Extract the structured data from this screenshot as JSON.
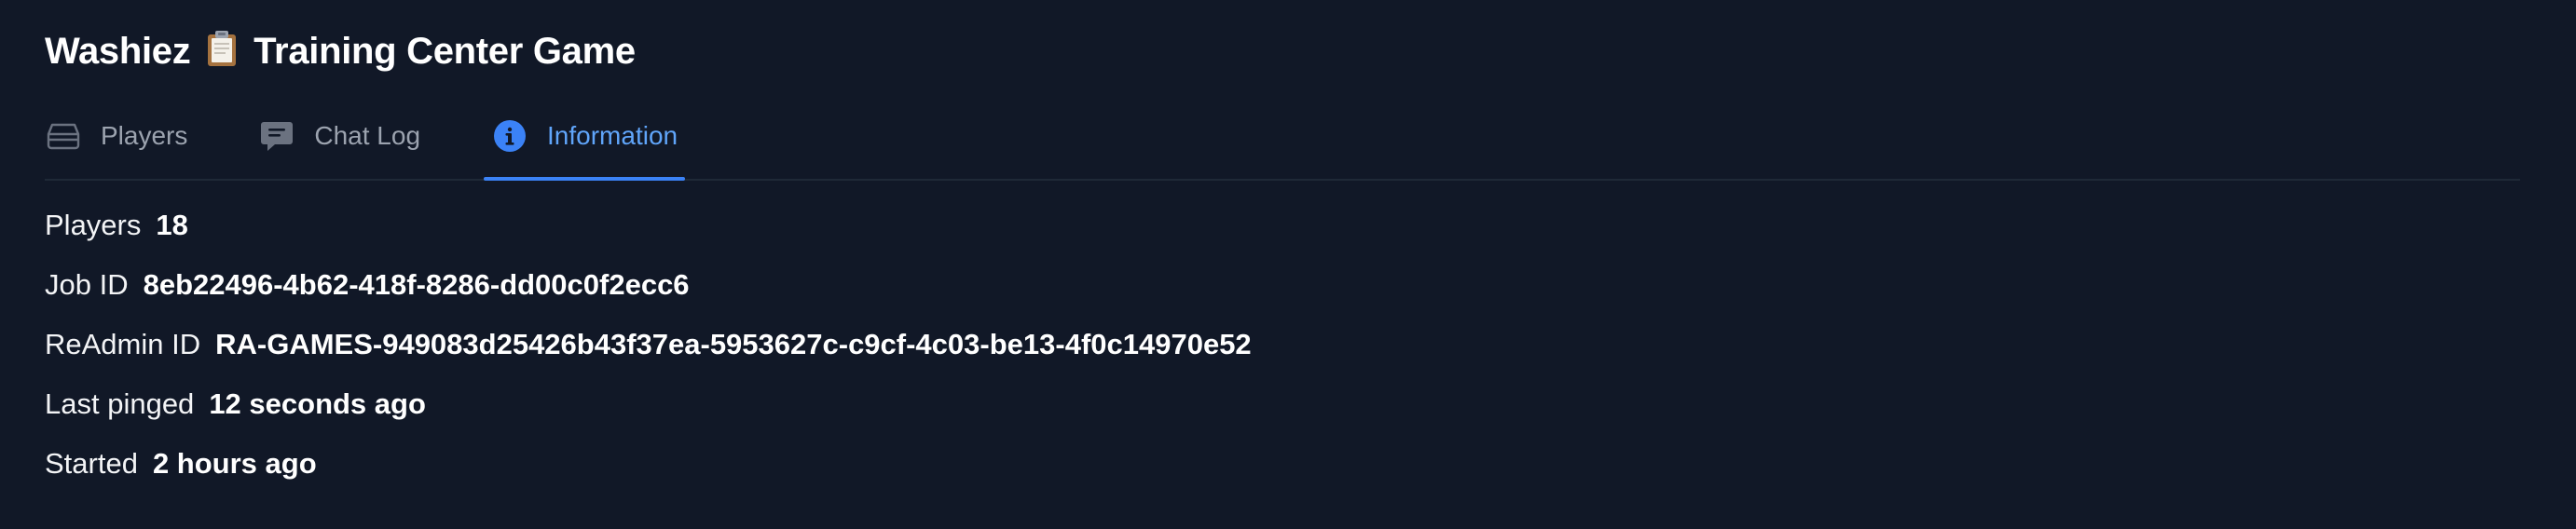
{
  "header": {
    "title_prefix": "Washiez",
    "title_emoji_icon": "clipboard-icon",
    "title_suffix": "Training Center Game"
  },
  "tabs": [
    {
      "label": "Players",
      "icon": "server-stack-icon",
      "active": false
    },
    {
      "label": "Chat Log",
      "icon": "chat-bubble-icon",
      "active": false
    },
    {
      "label": "Information",
      "icon": "info-circle-icon",
      "active": true
    }
  ],
  "info": {
    "players": {
      "label": "Players",
      "value": "18"
    },
    "job_id": {
      "label": "Job ID",
      "value": "8eb22496-4b62-418f-8286-dd00c0f2ecc6"
    },
    "readmin_id": {
      "label": "ReAdmin ID",
      "value": "RA-GAMES-949083d25426b43f37ea-5953627c-c9cf-4c03-be13-4f0c14970e52"
    },
    "last_pinged": {
      "label": "Last pinged",
      "value": "12 seconds ago"
    },
    "started": {
      "label": "Started",
      "value": "2 hours ago"
    }
  },
  "colors": {
    "background": "#111827",
    "accent": "#60a5fa",
    "muted": "#9ca3af",
    "text": "#f3f4f6"
  }
}
